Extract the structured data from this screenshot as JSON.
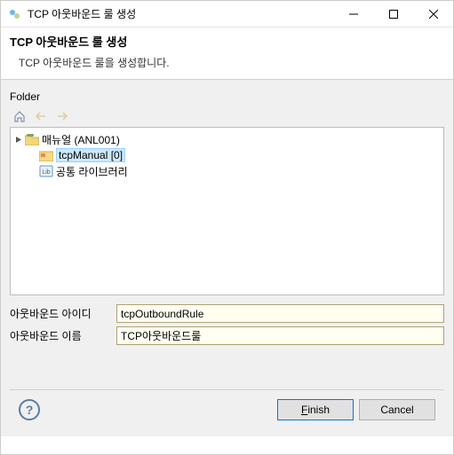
{
  "window": {
    "title": "TCP 아웃바운드 룰 생성"
  },
  "banner": {
    "title": "TCP 아웃바운드 룰 생성",
    "description": "TCP 아웃바운드 룰을 생성합니다."
  },
  "folder": {
    "label": "Folder",
    "toolbar": {
      "home_icon": "home-icon",
      "back_icon": "back-arrow-icon",
      "forward_icon": "forward-arrow-icon"
    },
    "tree": {
      "root": {
        "label": "매뉴얼  (ANL001)",
        "expanded": true,
        "children": [
          {
            "label": "tcpManual [0]",
            "selected": true,
            "icon": "folder-special"
          },
          {
            "label": "공통 라이브러리",
            "selected": false,
            "icon": "library"
          }
        ]
      }
    }
  },
  "form": {
    "id_label": "아웃바운드 아이디",
    "id_value": "tcpOutboundRule",
    "name_label": "아웃바운드 이름",
    "name_value": "TCP아웃바운드룰"
  },
  "buttons": {
    "help_tooltip": "Help",
    "finish": "Finish",
    "finish_mnemonic": "F",
    "finish_rest": "inish",
    "cancel": "Cancel"
  }
}
